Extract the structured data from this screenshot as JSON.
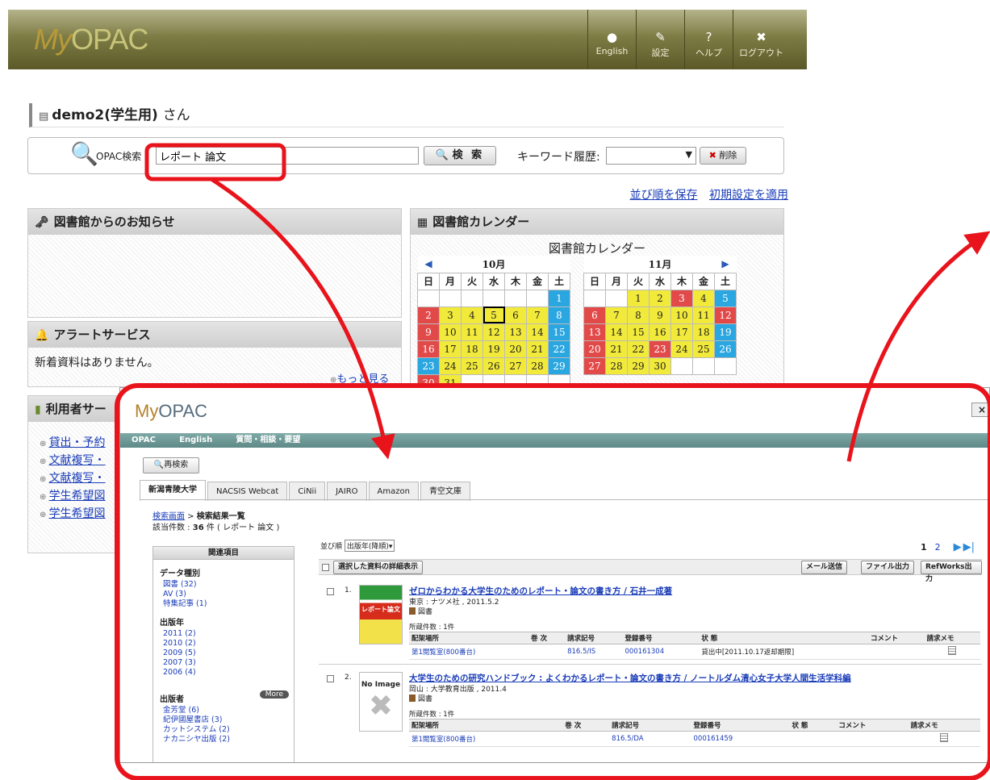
{
  "header": {
    "logo_my": "My",
    "logo_opac": "OPAC",
    "nav": [
      {
        "icon": "globe-icon",
        "glyph": "●",
        "label": "English"
      },
      {
        "icon": "wrench-icon",
        "glyph": "🔧",
        "label": "設定"
      },
      {
        "icon": "help-icon",
        "glyph": "?",
        "label": "ヘルプ"
      },
      {
        "icon": "close-icon",
        "glyph": "✖",
        "label": "ログアウト"
      }
    ]
  },
  "user": {
    "name": "demo2(学生用)",
    "suffix": "さん"
  },
  "search": {
    "label": "OPAC検索",
    "query": "レポート 論文",
    "button": "検 索",
    "history_label": "キーワード履歴:",
    "history_value": "",
    "delete_label": "削除"
  },
  "links": {
    "save_order": "並び順を保存",
    "apply_default": "初期設定を適用"
  },
  "panels": {
    "news": {
      "title": "図書館からのお知らせ"
    },
    "alert": {
      "title": "アラートサービス",
      "body": "新着資料はありません。",
      "more": "もっと見る"
    },
    "user_service": {
      "title": "利用者サー",
      "items": [
        "貸出・予約",
        "文献複写・",
        "文献複写・",
        "学生希望図",
        "学生希望図"
      ]
    }
  },
  "calendar": {
    "panel_title": "図書館カレンダー",
    "title": "図書館カレンダー",
    "weekdays": [
      "日",
      "月",
      "火",
      "水",
      "木",
      "金",
      "土"
    ],
    "months": [
      {
        "name": "10月",
        "rows": [
          [
            [
              "",
              ""
            ],
            [
              "",
              ""
            ],
            [
              "",
              ""
            ],
            [
              "",
              ""
            ],
            [
              "",
              ""
            ],
            [
              "",
              ""
            ],
            [
              "1",
              "b"
            ]
          ],
          [
            [
              "2",
              "r"
            ],
            [
              "3",
              "y"
            ],
            [
              "4",
              "y"
            ],
            [
              "5",
              "t"
            ],
            [
              "6",
              "y"
            ],
            [
              "7",
              "y"
            ],
            [
              "8",
              "b"
            ]
          ],
          [
            [
              "9",
              "r"
            ],
            [
              "10",
              "y"
            ],
            [
              "11",
              "y"
            ],
            [
              "12",
              "y"
            ],
            [
              "13",
              "y"
            ],
            [
              "14",
              "y"
            ],
            [
              "15",
              "b"
            ]
          ],
          [
            [
              "16",
              "r"
            ],
            [
              "17",
              "y"
            ],
            [
              "18",
              "y"
            ],
            [
              "19",
              "y"
            ],
            [
              "20",
              "y"
            ],
            [
              "21",
              "y"
            ],
            [
              "22",
              "b"
            ]
          ],
          [
            [
              "23",
              "b"
            ],
            [
              "24",
              "y"
            ],
            [
              "25",
              "y"
            ],
            [
              "26",
              "y"
            ],
            [
              "27",
              "y"
            ],
            [
              "28",
              "y"
            ],
            [
              "29",
              "b"
            ]
          ],
          [
            [
              "30",
              "r"
            ],
            [
              "31",
              "y"
            ],
            [
              "",
              ""
            ],
            [
              "",
              ""
            ],
            [
              "",
              ""
            ],
            [
              "",
              ""
            ],
            [
              "",
              ""
            ]
          ]
        ]
      },
      {
        "name": "11月",
        "rows": [
          [
            [
              "",
              ""
            ],
            [
              "",
              ""
            ],
            [
              "1",
              "y"
            ],
            [
              "2",
              "y"
            ],
            [
              "3",
              "r"
            ],
            [
              "4",
              "y"
            ],
            [
              "5",
              "b"
            ]
          ],
          [
            [
              "6",
              "r"
            ],
            [
              "7",
              "y"
            ],
            [
              "8",
              "y"
            ],
            [
              "9",
              "y"
            ],
            [
              "10",
              "y"
            ],
            [
              "11",
              "y"
            ],
            [
              "12",
              "r"
            ]
          ],
          [
            [
              "13",
              "r"
            ],
            [
              "14",
              "y"
            ],
            [
              "15",
              "y"
            ],
            [
              "16",
              "y"
            ],
            [
              "17",
              "y"
            ],
            [
              "18",
              "y"
            ],
            [
              "19",
              "b"
            ]
          ],
          [
            [
              "20",
              "r"
            ],
            [
              "21",
              "y"
            ],
            [
              "22",
              "y"
            ],
            [
              "23",
              "r"
            ],
            [
              "24",
              "y"
            ],
            [
              "25",
              "y"
            ],
            [
              "26",
              "b"
            ]
          ],
          [
            [
              "27",
              "r"
            ],
            [
              "28",
              "y"
            ],
            [
              "29",
              "y"
            ],
            [
              "30",
              "y"
            ],
            [
              "",
              ""
            ],
            [
              "",
              ""
            ],
            [
              "",
              ""
            ]
          ]
        ]
      }
    ]
  },
  "results": {
    "logo_my": "My",
    "logo_opac": "OPAC",
    "close": "×",
    "nav": [
      "OPAC",
      "English",
      "質問・相談・要望"
    ],
    "research_button": "再検索",
    "tabs": [
      "新潟青陵大学",
      "NACSIS Webcat",
      "CiNii",
      "JAIRO",
      "Amazon",
      "青空文庫"
    ],
    "breadcrumb_link": "検索画面",
    "breadcrumb_sep": " > ",
    "breadcrumb_current": "検索結果一覧",
    "count_prefix": "該当件数 : ",
    "count": "36",
    "count_suffix": " 件 ( レポート 論文 )",
    "sort_label": "並び順",
    "sort_value": "出版年(降順)",
    "detail_button": "選択した資料の詳細表示",
    "action_buttons": [
      "メール送信",
      "ファイル出力",
      "RefWorks出力"
    ],
    "pager": {
      "current": "1",
      "next_page": "2"
    },
    "facets": {
      "title": "関連項目",
      "groups": [
        {
          "title": "データ種別",
          "items": [
            "図書 (32)",
            "AV (3)",
            "特集記事 (1)"
          ]
        },
        {
          "title": "出版年",
          "items": [
            "2011 (2)",
            "2010 (2)",
            "2009 (5)",
            "2007 (3)",
            "2006 (4)"
          ]
        },
        {
          "title": "出版者",
          "items": [
            "金芳堂 (6)",
            "紀伊國屋書店 (3)",
            "カットシステム (2)",
            "ナカニシヤ出版 (2)"
          ]
        }
      ],
      "more": "More"
    },
    "holdings_headers": [
      "配架場所",
      "巻 次",
      "請求記号",
      "登録番号",
      "状 態",
      "コメント",
      "請求メモ"
    ],
    "records": [
      {
        "num": "1.",
        "title": "ゼロからわかる大学生のためのレポート・論文の書き方 / 石井一成著",
        "pub": "東京 : ナツメ社 , 2011.5.2",
        "type": "図書",
        "holdings": "所蔵件数 : 1件",
        "thumb_label": "レポート論文",
        "row": [
          "第1閲覧室(800番台)",
          "",
          "816.5/IS",
          "000161304",
          "貸出中[2011.10.17返却期限]",
          ""
        ]
      },
      {
        "num": "2.",
        "title": "大学生のための研究ハンドブック : よくわかるレポート・論文の書き方 / ノートルダム清心女子大学人間生活学科編",
        "pub": "岡山 : 大学教育出版 , 2011.4",
        "type": "図書",
        "holdings": "所蔵件数 : 1件",
        "thumb_label": "No Image",
        "row": [
          "第1閲覧室(800番台)",
          "",
          "816.5/DA",
          "000161459",
          "",
          ""
        ]
      }
    ]
  },
  "colors": {
    "annotation": "#e8131b",
    "cal_yellow": "#f2ea3a",
    "cal_red": "#e24a4a",
    "cal_blue": "#2aa6e0"
  }
}
